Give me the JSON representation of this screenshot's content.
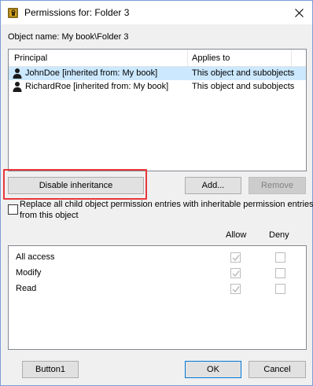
{
  "window": {
    "title": "Permissions for: Folder 3"
  },
  "object_name": "Object name: My book\\Folder 3",
  "principals": {
    "headers": {
      "principal": "Principal",
      "applies_to": "Applies to"
    },
    "rows": [
      {
        "principal": "JohnDoe [inherited from: My book]",
        "applies_to": "This object and subobjects",
        "selected": true
      },
      {
        "principal": "RichardRoe [inherited from: My book]",
        "applies_to": "This object and subobjects",
        "selected": false
      }
    ]
  },
  "buttons": {
    "disable_inheritance": "Disable inheritance",
    "add": "Add...",
    "remove": "Remove",
    "button1": "Button1",
    "ok": "OK",
    "cancel": "Cancel"
  },
  "replace_option": {
    "line1": "Replace all child object permission entries with inheritable permission entries",
    "line2": "from this object",
    "checked": false
  },
  "permissions": {
    "headers": {
      "allow": "Allow",
      "deny": "Deny"
    },
    "rows": [
      {
        "name": "All access",
        "allow": true,
        "deny": false
      },
      {
        "name": "Modify",
        "allow": true,
        "deny": false
      },
      {
        "name": "Read",
        "allow": true,
        "deny": false
      }
    ]
  },
  "colors": {
    "highlight": "#e8373a",
    "selection": "#cce8ff",
    "default_button_border": "#0078d7"
  }
}
